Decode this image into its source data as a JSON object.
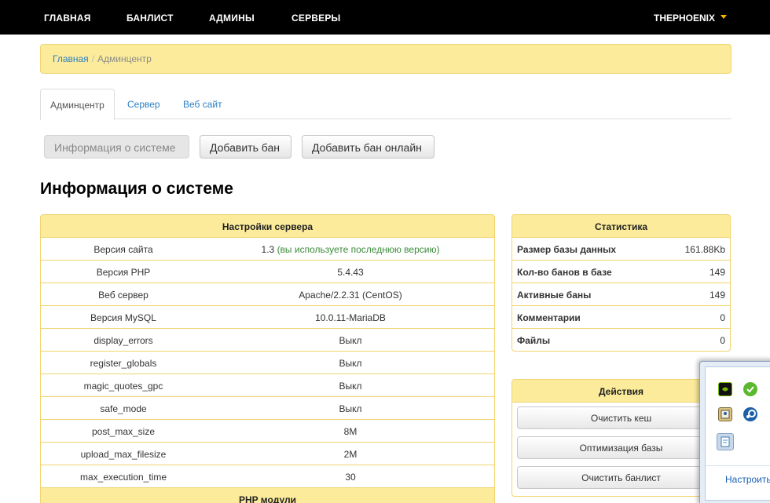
{
  "nav": {
    "items": [
      "ГЛАВНАЯ",
      "БАНЛИСТ",
      "АДМИНЫ",
      "СЕРВЕРЫ"
    ],
    "user": "THEPHOENIX"
  },
  "breadcrumb": {
    "home": "Главная",
    "sep": "/",
    "current": "Админцентр"
  },
  "tabs": [
    "Админцентр",
    "Сервер",
    "Веб сайт"
  ],
  "buttons": [
    "Информация о системе",
    "Добавить бан",
    "Добавить бан онлайн"
  ],
  "page_title": "Информация о системе",
  "server": {
    "title": "Настройки сервера",
    "rows": [
      {
        "key": "Версия сайта",
        "value": "1.3",
        "note": "(вы используете последнюю версию)"
      },
      {
        "key": "Версия PHP",
        "value": "5.4.43"
      },
      {
        "key": "Веб сервер",
        "value": "Apache/2.2.31 (CentOS)"
      },
      {
        "key": "Версия MySQL",
        "value": "10.0.11-MariaDB"
      },
      {
        "key": "display_errors",
        "value": "Выкл"
      },
      {
        "key": "register_globals",
        "value": "Выкл"
      },
      {
        "key": "magic_quotes_gpc",
        "value": "Выкл"
      },
      {
        "key": "safe_mode",
        "value": "Выкл"
      },
      {
        "key": "post_max_size",
        "value": "8M"
      },
      {
        "key": "upload_max_filesize",
        "value": "2M"
      },
      {
        "key": "max_execution_time",
        "value": "30"
      }
    ],
    "modules_title": "PHP модули"
  },
  "stats": {
    "title": "Статистика",
    "rows": [
      {
        "key": "Размер базы данных",
        "value": "161.88Kb"
      },
      {
        "key": "Кол-во банов в базе",
        "value": "149"
      },
      {
        "key": "Активные баны",
        "value": "149"
      },
      {
        "key": "Комментарии",
        "value": "0"
      },
      {
        "key": "Файлы",
        "value": "0"
      }
    ]
  },
  "actions": {
    "title": "Действия",
    "buttons": [
      "Очистить кеш",
      "Оптимизация базы",
      "Очистить банлист"
    ]
  },
  "tray": {
    "link": "Настроить...",
    "icons": [
      "nvidia-icon",
      "green-check-app-icon",
      "contact-card-icon",
      "steam-icon",
      "clipboard-app-icon"
    ]
  },
  "colors": {
    "accent": "#fbeb9b",
    "border": "#f1d46f",
    "link": "#2a7fc4",
    "navbar": "#000000"
  }
}
